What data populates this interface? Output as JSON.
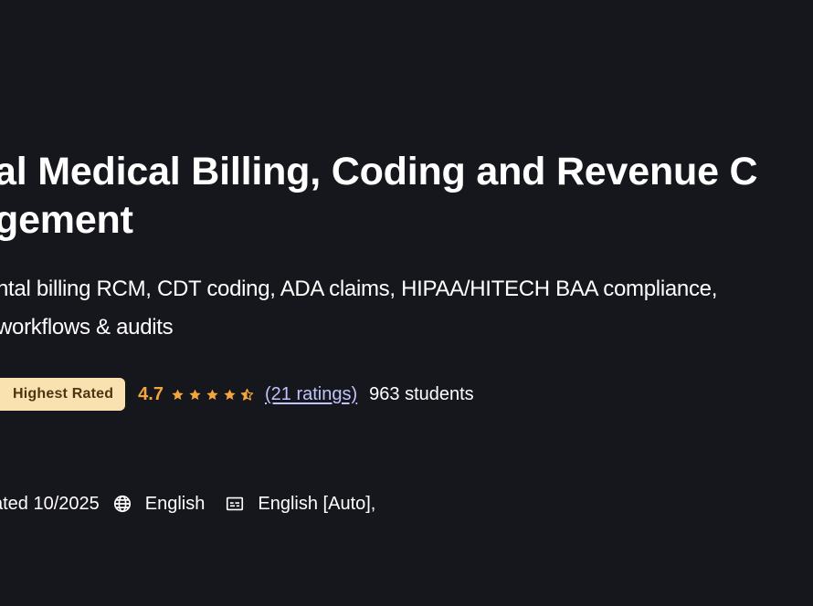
{
  "course": {
    "title_lines": [
      "al Medical Billing, Coding and Revenue C",
      "gement"
    ],
    "subtitle_lines": [
      "ntal billing RCM, CDT coding, ADA claims, HIPAA/HITECH BAA compliance,",
      "workflows & audits"
    ],
    "badge": "Highest Rated",
    "rating": "4.7",
    "stars_filled": 4.5,
    "ratings_link": "(21 ratings)",
    "students": "963 students",
    "last_updated": "ated 10/2025",
    "language": "English",
    "captions": "English [Auto],"
  },
  "colors": {
    "background": "#16161d",
    "badge_bg": "#f9e1b0",
    "badge_text": "#4e3511",
    "rating": "#f3a63b",
    "link": "#c0c4fc"
  },
  "icons": {
    "globe": "globe-icon",
    "captions": "closed-captions-icon",
    "star": "star-icon",
    "half_star": "half-star-icon"
  }
}
